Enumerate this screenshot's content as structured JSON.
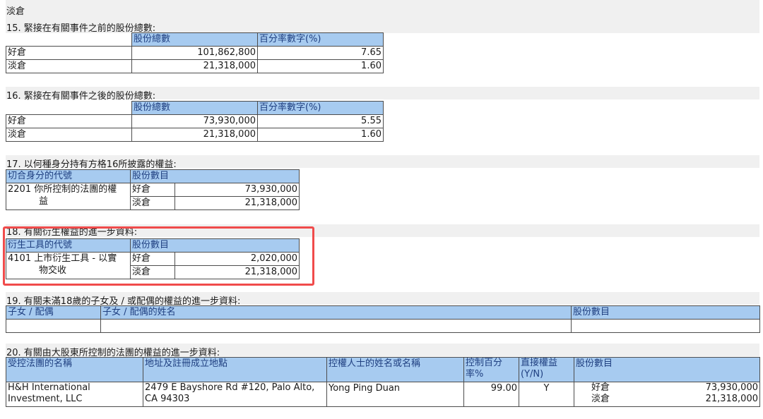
{
  "top_label": "淡倉",
  "section15": {
    "title": "15. 緊接在有關事件之前的股份總數:",
    "headers": [
      "股份總數",
      "百分率數字(%)"
    ],
    "rows": [
      {
        "label": "好倉",
        "shares": "101,862,800",
        "pct": "7.65"
      },
      {
        "label": "淡倉",
        "shares": "21,318,000",
        "pct": "1.60"
      }
    ]
  },
  "section16": {
    "title": "16. 緊接在有關事件之後的股份總數:",
    "headers": [
      "股份總數",
      "百分率數字(%)"
    ],
    "rows": [
      {
        "label": "好倉",
        "shares": "73,930,000",
        "pct": "5.55"
      },
      {
        "label": "淡倉",
        "shares": "21,318,000",
        "pct": "1.60"
      }
    ]
  },
  "section17": {
    "title": "17. 以何種身分持有方格16所披露的權益:",
    "headers": [
      "切合身分的代號",
      "股份數目"
    ],
    "code": "2201",
    "desc_line1": "你所控制的法團的權",
    "desc_line2": "益",
    "rows": [
      {
        "label": "好倉",
        "shares": "73,930,000"
      },
      {
        "label": "淡倉",
        "shares": "21,318,000"
      }
    ]
  },
  "section18": {
    "title": "18. 有關衍生權益的進一步資料:",
    "headers": [
      "衍生工具的代號",
      "股份數目"
    ],
    "code": "4101",
    "desc_line1": "上市衍生工具 - 以實",
    "desc_line2": "物交收",
    "rows": [
      {
        "label": "好倉",
        "shares": "2,020,000"
      },
      {
        "label": "淡倉",
        "shares": "21,318,000"
      }
    ]
  },
  "section19": {
    "title": "19. 有關未滿18歲的子女及 / 或配偶的權益的進一步資料:",
    "headers": [
      "子女 / 配偶",
      "子女 / 配偶的姓名",
      "股份數目"
    ]
  },
  "section20": {
    "title": "20. 有關由大股東所控制的法團的權益的進一步資料:",
    "headers": [
      "受控法團的名稱",
      "地址及註冊成立地點",
      "控權人士的姓名或名稱",
      "控制百分率%",
      "直接權益(Y/N)",
      "股份數目"
    ],
    "row": {
      "name": "H&H International Investment, LLC",
      "address": "2479 E Bayshore Rd #120, Palo Alto, CA 94303",
      "controller": "Yong Ping Duan",
      "pct": "99.00",
      "direct": "Y",
      "long_label": "好倉",
      "long_shares": "73,930,000",
      "short_label": "淡倉",
      "short_shares": "21,318,000"
    }
  },
  "colors": {
    "header_bg": "#a7cbf0",
    "band_bg": "#f0f0f0",
    "highlight": "#f04b4b"
  }
}
